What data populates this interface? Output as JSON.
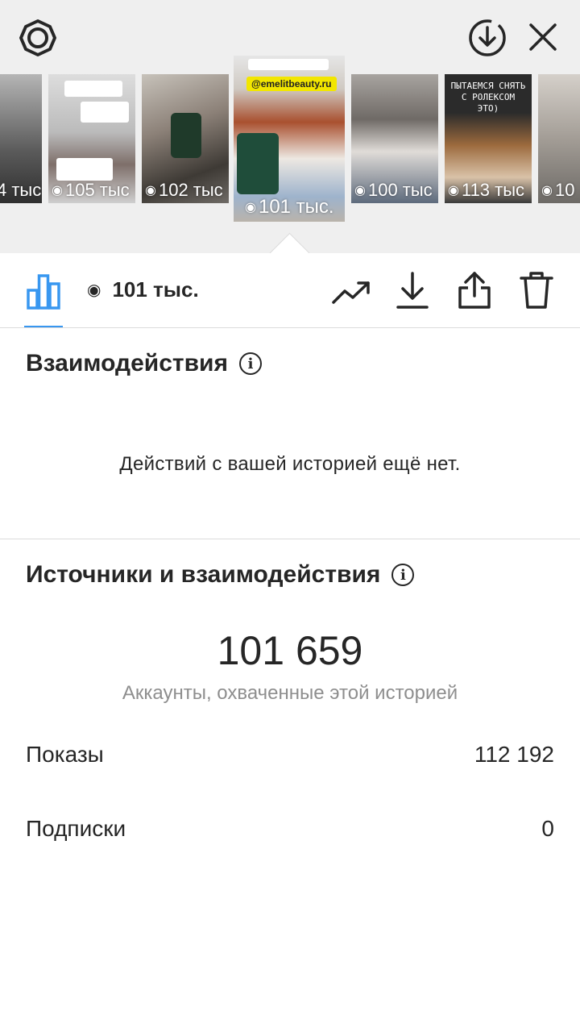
{
  "header": {
    "icons": [
      "settings-icon",
      "download-circle-icon",
      "close-icon"
    ]
  },
  "stories": [
    {
      "views": "4 тыс",
      "color": "#4a4a4a",
      "selected": false
    },
    {
      "views": "105 тыс",
      "color": "#c9c9c9",
      "selected": false
    },
    {
      "views": "102 тыс",
      "color": "#6d6a66",
      "selected": false
    },
    {
      "views": "101 тыс.",
      "color": "#b8b2aa",
      "selected": true,
      "tag": "@emelitbeauty.ru"
    },
    {
      "views": "100 тыс",
      "color": "#8f8a86",
      "selected": false
    },
    {
      "views": "113 тыс",
      "color": "#3a3a3a",
      "selected": false,
      "overlay_text": "ПЫТАЕМСЯ СНЯТЬ С РОЛЕКСОМ ЭТО)"
    },
    {
      "views": "10",
      "color": "#9a9690",
      "selected": false
    }
  ],
  "toolbar": {
    "views": "101 тыс.",
    "icons": [
      "insights-bar-icon",
      "eye-icon",
      "trend-icon",
      "download-icon",
      "share-icon",
      "trash-icon"
    ],
    "accent": "#3897f0"
  },
  "interactions": {
    "title": "Взаимодействия",
    "empty_text": "Действий с вашей историей ещё нет."
  },
  "discovery": {
    "title": "Источники и взаимодействия",
    "reach_value": "101 659",
    "reach_caption": "Аккаунты, охваченные этой историей",
    "rows": [
      {
        "label": "Показы",
        "value": "112 192"
      },
      {
        "label": "Подписки",
        "value": "0"
      }
    ]
  }
}
